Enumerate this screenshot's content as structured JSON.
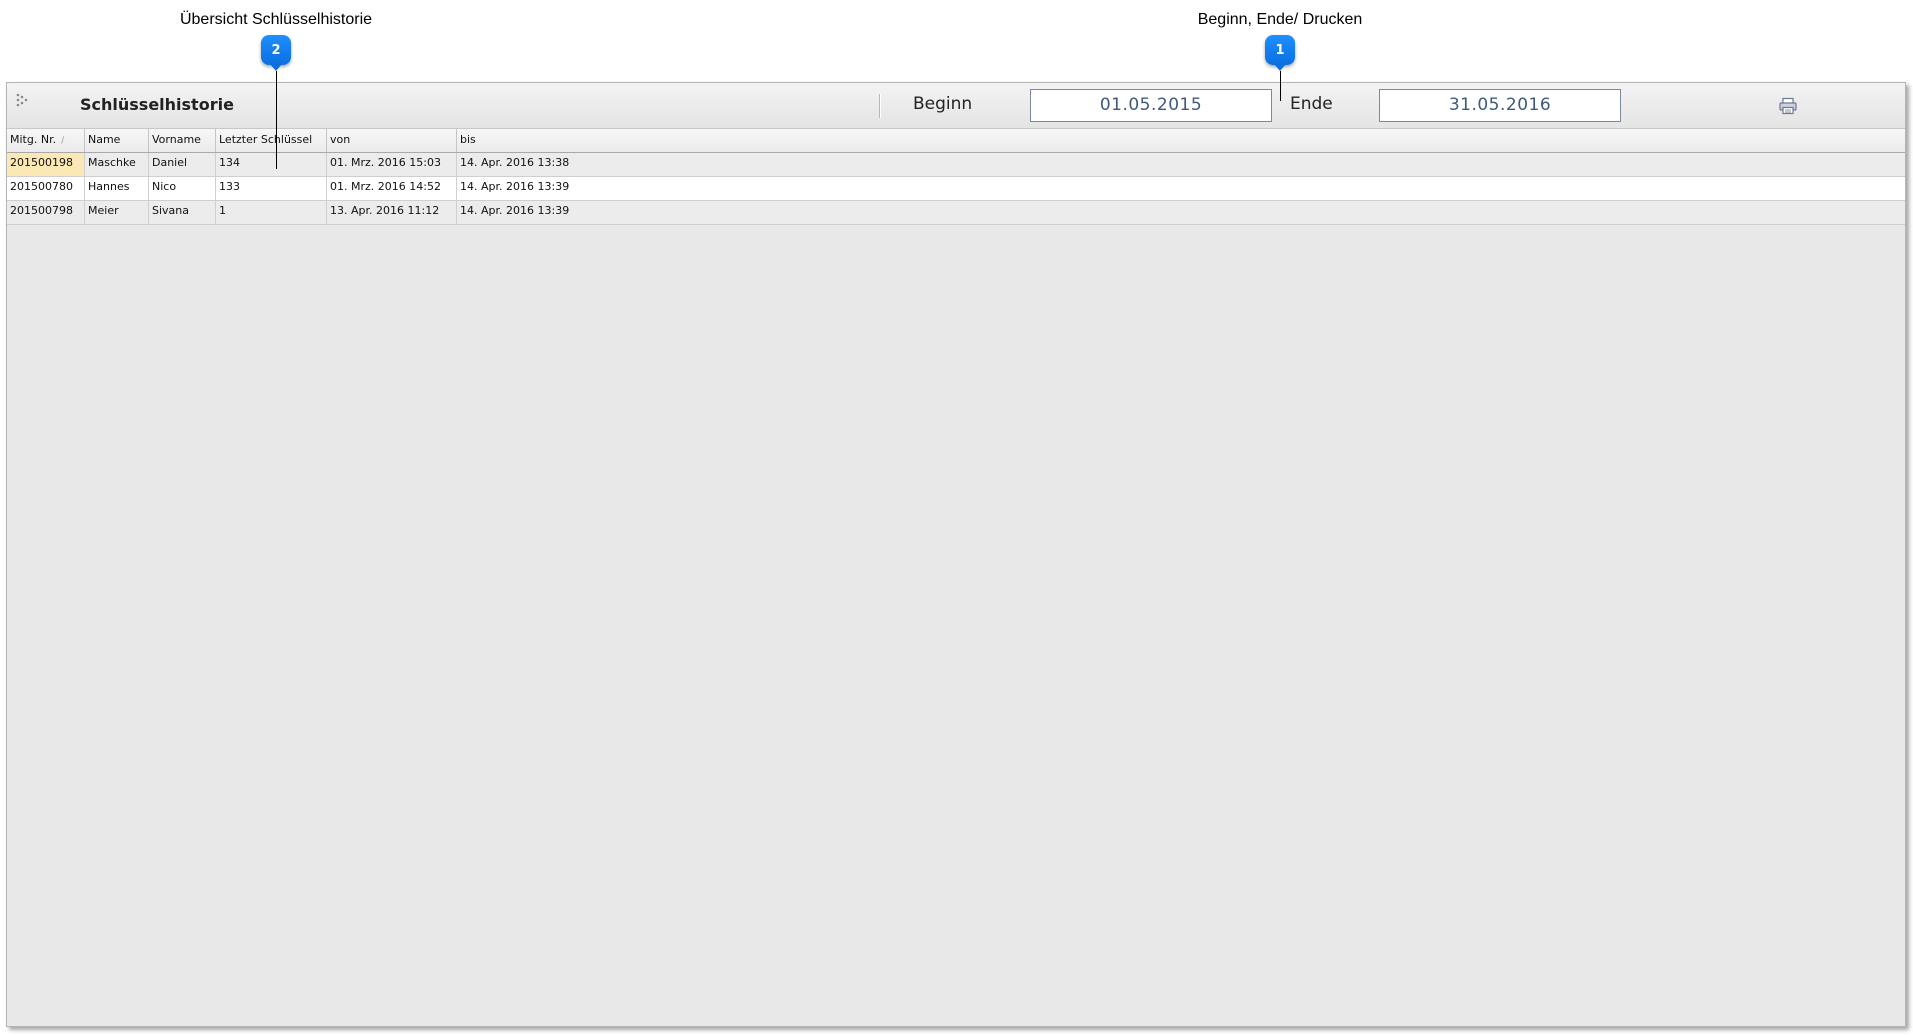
{
  "callouts": [
    {
      "number": "2",
      "text": "Übersicht Schlüsselhistorie"
    },
    {
      "number": "1",
      "text": "Beginn, Ende/ Drucken"
    }
  ],
  "window": {
    "title": "Schlüsselhistorie",
    "begin_label": "Beginn",
    "begin_value": "01.05.2015",
    "end_label": "Ende",
    "end_value": "31.05.2016",
    "menu_icon": "grid-dots-icon",
    "print_icon": "printer-icon"
  },
  "table": {
    "columns": [
      "Mitg. Nr.",
      "Name",
      "Vorname",
      "Letzter Schlüssel",
      "von",
      "bis"
    ],
    "sort_indicator": "/",
    "rows": [
      [
        "201500198",
        "Maschke",
        "Daniel",
        "134",
        "01. Mrz. 2016 15:03",
        "14. Apr. 2016 13:38"
      ],
      [
        "201500780",
        "Hannes",
        "Nico",
        "133",
        "01. Mrz. 2016 14:52",
        "14. Apr. 2016 13:39"
      ],
      [
        "201500798",
        "Meier",
        "Sivana",
        "1",
        "13. Apr. 2016 11:12",
        "14. Apr. 2016 13:39"
      ]
    ]
  },
  "colors": {
    "callout_badge": "#0a7cf0",
    "selected_cell": "#fbe8b4",
    "window_bg": "#e8e8e8"
  }
}
